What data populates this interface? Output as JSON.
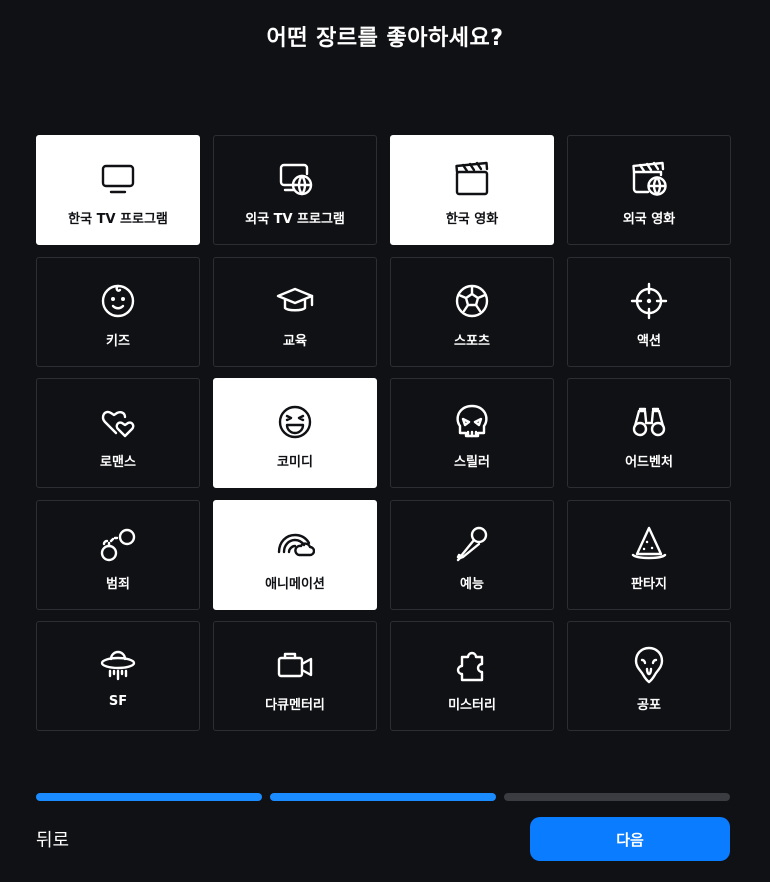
{
  "header": {
    "title": "어떤 장르를 좋아하세요?"
  },
  "genres": [
    {
      "label": "한국 TV 프로그램",
      "icon": "tv-icon",
      "selected": true
    },
    {
      "label": "외국 TV 프로그램",
      "icon": "tv-globe-icon",
      "selected": false
    },
    {
      "label": "한국 영화",
      "icon": "clapperboard-icon",
      "selected": true
    },
    {
      "label": "외국 영화",
      "icon": "clapperboard-globe-icon",
      "selected": false
    },
    {
      "label": "키즈",
      "icon": "baby-face-icon",
      "selected": false
    },
    {
      "label": "교육",
      "icon": "graduation-cap-icon",
      "selected": false
    },
    {
      "label": "스포츠",
      "icon": "soccer-ball-icon",
      "selected": false
    },
    {
      "label": "액션",
      "icon": "crosshair-icon",
      "selected": false
    },
    {
      "label": "로맨스",
      "icon": "hearts-icon",
      "selected": false
    },
    {
      "label": "코미디",
      "icon": "laughing-face-icon",
      "selected": true
    },
    {
      "label": "스릴러",
      "icon": "skull-icon",
      "selected": false
    },
    {
      "label": "어드벤처",
      "icon": "binoculars-icon",
      "selected": false
    },
    {
      "label": "범죄",
      "icon": "handcuffs-icon",
      "selected": false
    },
    {
      "label": "애니메이션",
      "icon": "rainbow-cloud-icon",
      "selected": true
    },
    {
      "label": "예능",
      "icon": "microphone-icon",
      "selected": false
    },
    {
      "label": "판타지",
      "icon": "wizard-hat-icon",
      "selected": false
    },
    {
      "label": "SF",
      "icon": "ufo-icon",
      "selected": false
    },
    {
      "label": "다큐멘터리",
      "icon": "video-camera-icon",
      "selected": false
    },
    {
      "label": "미스터리",
      "icon": "puzzle-piece-icon",
      "selected": false
    },
    {
      "label": "공포",
      "icon": "ghost-mask-icon",
      "selected": false
    }
  ],
  "progress": {
    "completed_steps": 2,
    "total_steps": 3
  },
  "footer": {
    "back_label": "뒤로",
    "next_label": "다음"
  },
  "colors": {
    "background": "#101114",
    "accent": "#0a7cff",
    "progress_done": "#1a8cff",
    "progress_todo": "#3a3c42",
    "selected_tile": "#ffffff"
  }
}
